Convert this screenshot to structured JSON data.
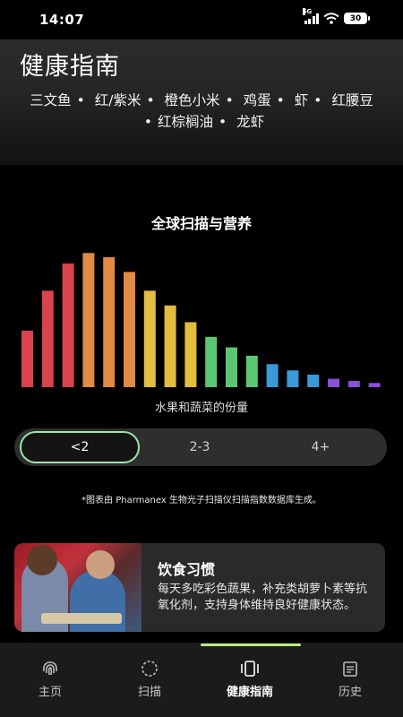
{
  "status_bar": {
    "time": "14:07",
    "network": "5G",
    "battery": "30"
  },
  "header": {
    "title": "健康指南",
    "foods": [
      "三文鱼",
      "红/紫米",
      "橙色小米",
      "鸡蛋",
      "虾",
      "红腰豆",
      "红棕榈油",
      "龙虾"
    ]
  },
  "chart_data": {
    "type": "bar",
    "title": "全球扫描与营养",
    "xlabel": "水果和蔬菜的份量",
    "values": [
      27,
      46,
      59,
      64,
      62,
      55,
      46,
      39,
      31,
      24,
      19,
      15,
      11,
      8,
      6,
      4,
      3,
      2
    ],
    "colors": [
      "#d9434b",
      "#d9434b",
      "#d9434b",
      "#e08a43",
      "#e08a43",
      "#e08a43",
      "#e3bd40",
      "#e3bd40",
      "#e3bd40",
      "#5cc772",
      "#5cc772",
      "#5cc772",
      "#3a9ad9",
      "#3a9ad9",
      "#3a9ad9",
      "#8a4fd6",
      "#8a4fd6",
      "#8a4fd6"
    ]
  },
  "segment": {
    "options": [
      "<2",
      "2-3",
      "4+"
    ],
    "selected": "<2"
  },
  "footnote": "*图表由 Pharmanex 生物光子扫描仪扫描指数数据库生成。",
  "card": {
    "title": "饮食习惯",
    "body": "每天多吃彩色蔬果，补充类胡萝卜素等抗氧化剂，支持身体维持良好健康状态。"
  },
  "nav": {
    "items": [
      {
        "label": "主页",
        "icon": "fingerprint-icon"
      },
      {
        "label": "扫描",
        "icon": "scan-circle-icon"
      },
      {
        "label": "健康指南",
        "icon": "guide-card-icon"
      },
      {
        "label": "历史",
        "icon": "history-document-icon"
      }
    ],
    "active": "健康指南"
  }
}
